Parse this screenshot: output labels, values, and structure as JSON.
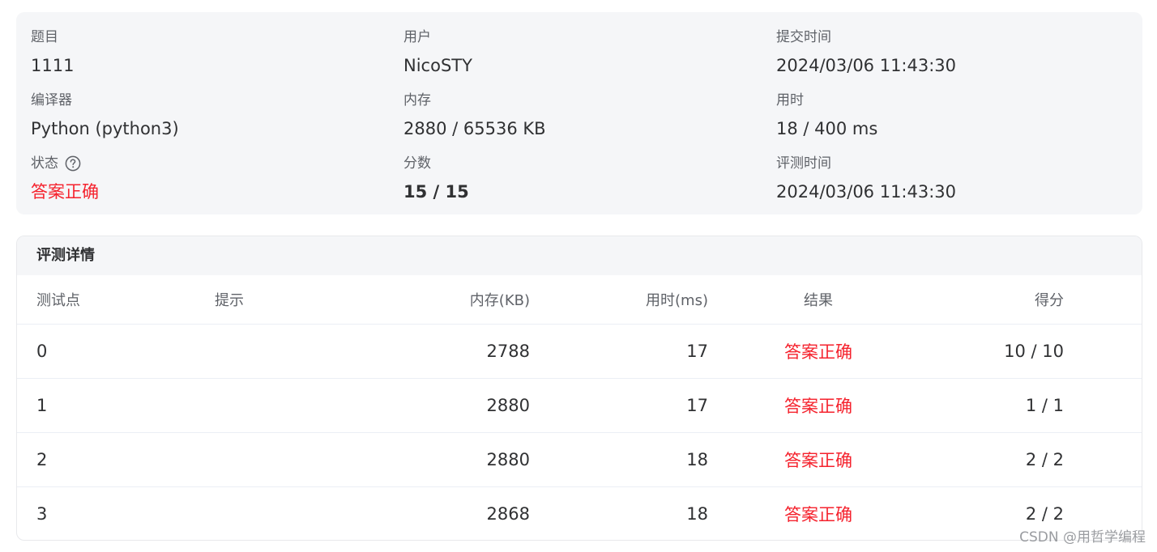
{
  "info": {
    "problem": {
      "label": "题目",
      "value": "1111"
    },
    "user": {
      "label": "用户",
      "value": "NicoSTY"
    },
    "submit_time": {
      "label": "提交时间",
      "value": "2024/03/06 11:43:30"
    },
    "compiler": {
      "label": "编译器",
      "value": "Python (python3)"
    },
    "memory": {
      "label": "内存",
      "value": "2880 / 65536 KB"
    },
    "time_used": {
      "label": "用时",
      "value": "18 / 400 ms"
    },
    "status": {
      "label": "状态",
      "value": "答案正确",
      "help_icon": "question-circle-icon"
    },
    "score": {
      "label": "分数",
      "value": "15 / 15"
    },
    "judge_time": {
      "label": "评测时间",
      "value": "2024/03/06 11:43:30"
    }
  },
  "detail": {
    "title": "评测详情",
    "columns": {
      "point": "测试点",
      "hint": "提示",
      "memory": "内存(KB)",
      "time": "用时(ms)",
      "result": "结果",
      "score": "得分"
    },
    "rows": [
      {
        "point": "0",
        "hint": "",
        "memory": "2788",
        "time": "17",
        "result": "答案正确",
        "score": "10 / 10"
      },
      {
        "point": "1",
        "hint": "",
        "memory": "2880",
        "time": "17",
        "result": "答案正确",
        "score": "1 / 1"
      },
      {
        "point": "2",
        "hint": "",
        "memory": "2880",
        "time": "18",
        "result": "答案正确",
        "score": "2 / 2"
      },
      {
        "point": "3",
        "hint": "",
        "memory": "2868",
        "time": "18",
        "result": "答案正确",
        "score": "2 / 2"
      }
    ]
  },
  "colors": {
    "accepted": "#f5222d",
    "card_bg": "#f5f6f8"
  },
  "watermark": "CSDN @用哲学编程"
}
